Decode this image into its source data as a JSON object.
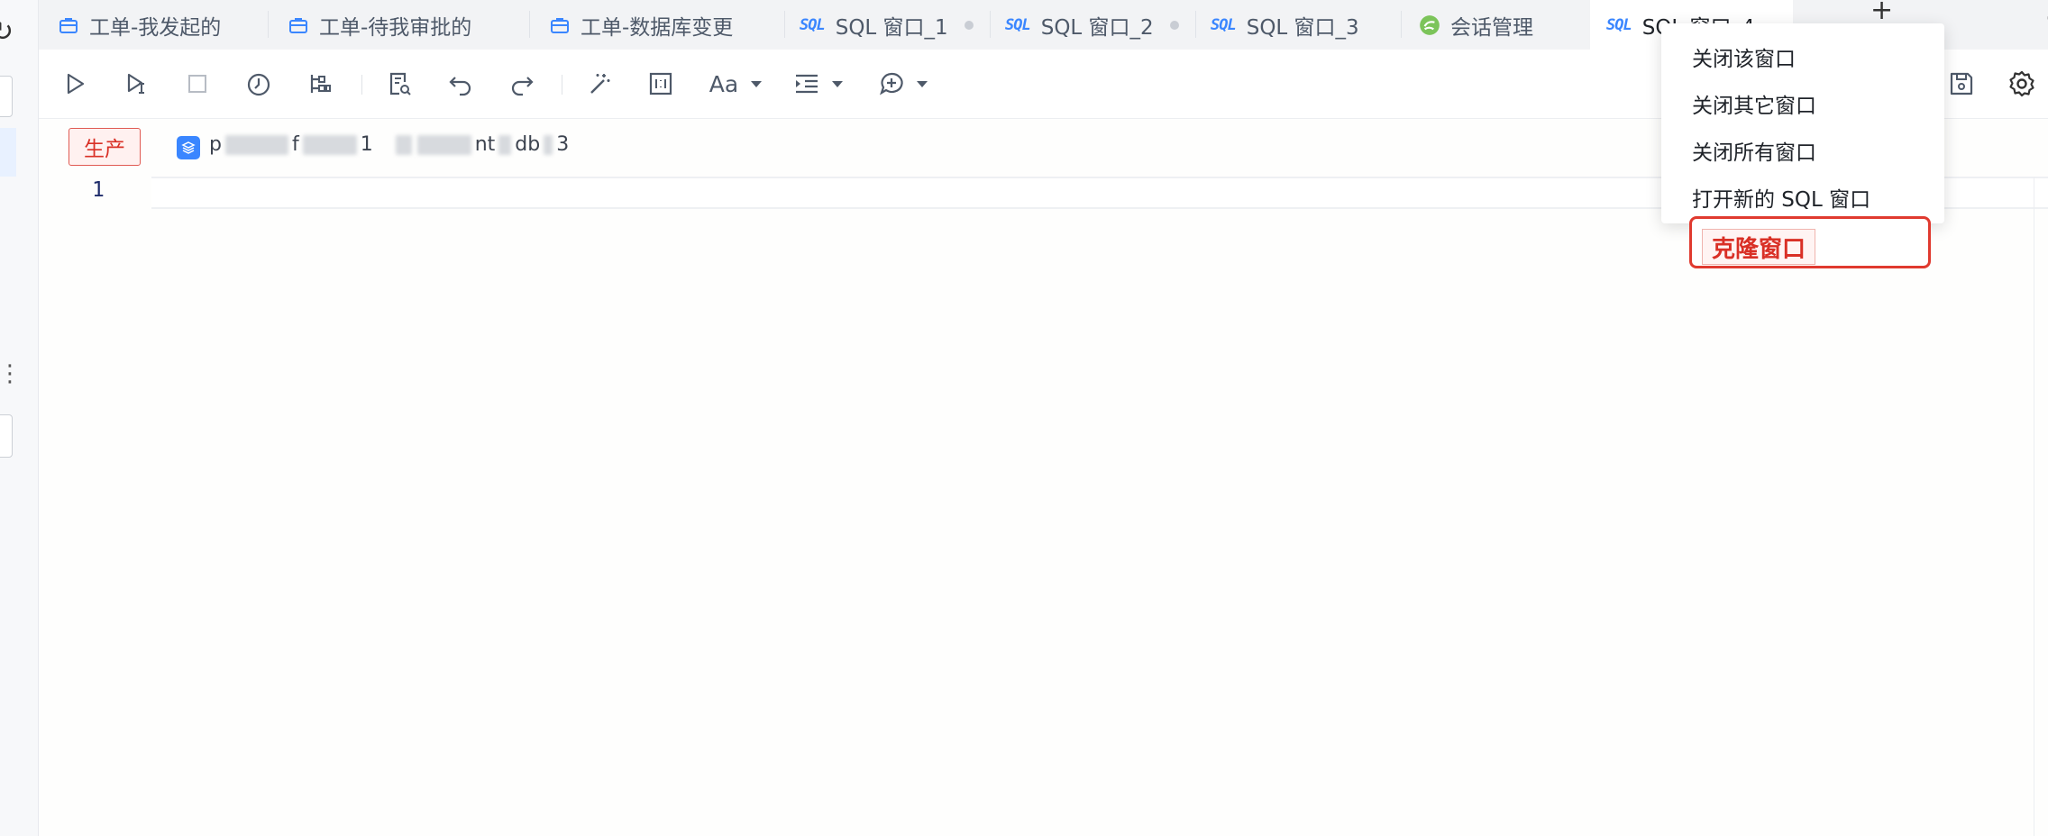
{
  "tabs": [
    {
      "label": "工单-我发起的",
      "icon": "briefcase-icon"
    },
    {
      "label": "工单-待我审批的",
      "icon": "briefcase-icon"
    },
    {
      "label": "工单-数据库变更",
      "icon": "briefcase-icon"
    },
    {
      "label": "SQL 窗口_1",
      "icon": "sql-icon",
      "icon_text": "SQL"
    },
    {
      "label": "SQL 窗口_2",
      "icon": "sql-icon",
      "icon_text": "SQL"
    },
    {
      "label": "SQL 窗口_3",
      "icon": "sql-icon",
      "icon_text": "SQL"
    },
    {
      "label": "会话管理",
      "icon": "session-icon"
    },
    {
      "label": "SQL 窗口_4",
      "icon": "sql-icon",
      "icon_text": "SQL",
      "active": true
    }
  ],
  "tabbar": {
    "add_label": "+",
    "more_label": "···"
  },
  "toolbar": {
    "font_label": "Aa",
    "buttons": [
      "run-icon",
      "run-selected-icon",
      "stop-icon",
      "history-icon",
      "explain-icon",
      "search-doc-icon",
      "undo-icon",
      "redo-icon",
      "format-icon",
      "layout-icon",
      "font-icon",
      "indent-icon",
      "comment-icon",
      "save-icon",
      "settings-icon"
    ]
  },
  "connection": {
    "env_tag": "生产",
    "instance_part1": "p",
    "instance_part2": "f",
    "instance_part3": "1",
    "db_part1": "nt",
    "db_part2": "db",
    "db_part3": "3"
  },
  "editor": {
    "line_numbers": [
      "1"
    ]
  },
  "context_menu": {
    "items": [
      "关闭该窗口",
      "关闭其它窗口",
      "关闭所有窗口",
      "打开新的 SQL 窗口"
    ],
    "highlighted": "克隆窗口"
  },
  "colors": {
    "accent": "#3a86ff",
    "danger": "#d93026",
    "tabbar_bg": "#f2f3f5"
  }
}
